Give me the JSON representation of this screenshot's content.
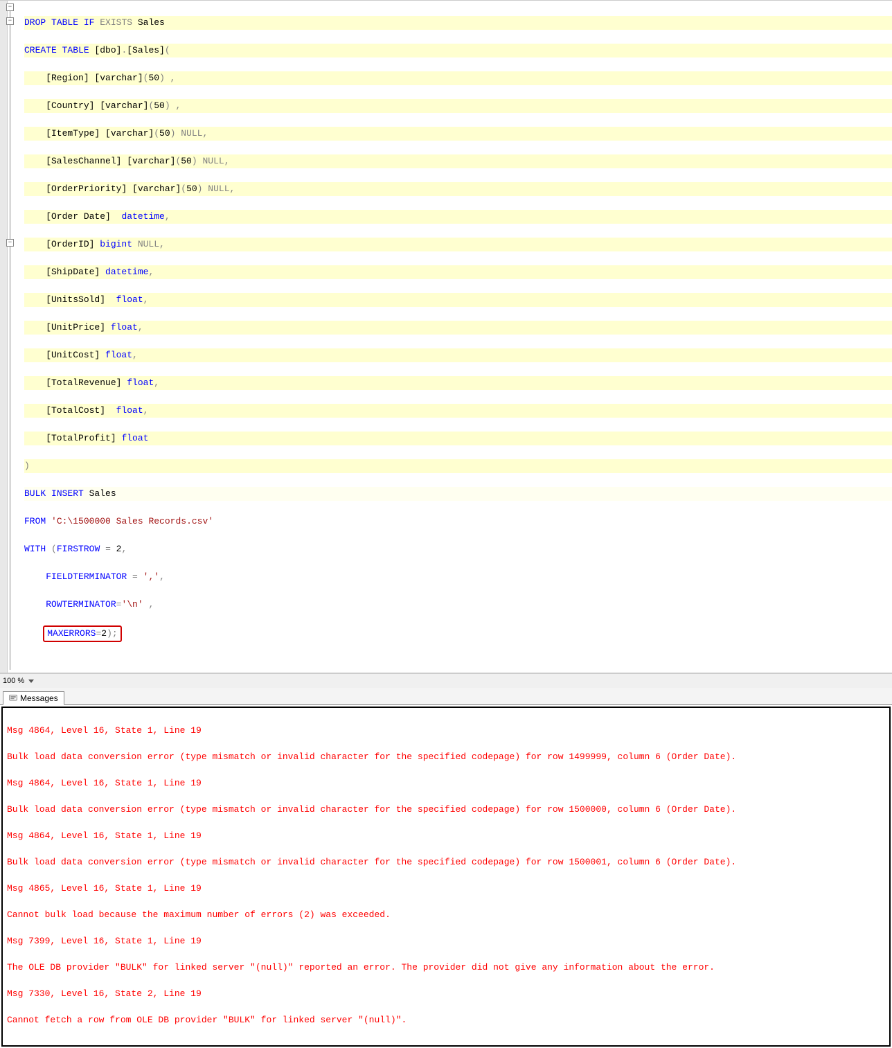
{
  "zoom": "100 %",
  "messagesTab": "Messages",
  "code": {
    "l1": {
      "a": "DROP",
      "b": " TABLE",
      "c": " IF",
      "d": " EXISTS",
      "e": " Sales"
    },
    "l2": {
      "a": "CREATE",
      "b": " TABLE",
      "c": " [dbo]",
      "d": ".",
      "e": "[Sales]",
      "f": "("
    },
    "l3": {
      "a": "    [Region] [varchar]",
      "b": "(",
      "c": "50",
      "d": ")",
      "e": " ,"
    },
    "l4": {
      "a": "    [Country] [varchar]",
      "b": "(",
      "c": "50",
      "d": ")",
      "e": " ,"
    },
    "l5": {
      "a": "    [ItemType] [varchar]",
      "b": "(",
      "c": "50",
      "d": ")",
      "e": " NULL",
      "f": ","
    },
    "l6": {
      "a": "    [SalesChannel] [varchar]",
      "b": "(",
      "c": "50",
      "d": ")",
      "e": " NULL",
      "f": ","
    },
    "l7": {
      "a": "    [OrderPriority] [varchar]",
      "b": "(",
      "c": "50",
      "d": ")",
      "e": " NULL",
      "f": ","
    },
    "l8": {
      "a": "    [Order Date]  ",
      "b": "datetime",
      "c": ","
    },
    "l9": {
      "a": "    [OrderID] ",
      "b": "bigint",
      "c": " NULL",
      "d": ","
    },
    "l10": {
      "a": "    [ShipDate] ",
      "b": "datetime",
      "c": ","
    },
    "l11": {
      "a": "    [UnitsSold]  ",
      "b": "float",
      "c": ","
    },
    "l12": {
      "a": "    [UnitPrice] ",
      "b": "float",
      "c": ","
    },
    "l13": {
      "a": "    [UnitCost] ",
      "b": "float",
      "c": ","
    },
    "l14": {
      "a": "    [TotalRevenue] ",
      "b": "float",
      "c": ","
    },
    "l15": {
      "a": "    [TotalCost]  ",
      "b": "float",
      "c": ","
    },
    "l16": {
      "a": "    [TotalProfit] ",
      "b": "float"
    },
    "l17": {
      "a": ")"
    },
    "l18": {
      "a": "BULK",
      "b": " INSERT",
      "c": " Sales"
    },
    "l19": {
      "a": "FROM",
      "b": " ",
      "c": "'C:\\1500000 Sales Records.csv'"
    },
    "l20": {
      "a": "WITH",
      "b": " ",
      "c": "(",
      "d": "FIRSTROW",
      "e": " =",
      "f": " 2",
      "g": ","
    },
    "l21": {
      "a": "    ",
      "b": "FIELDTERMINATOR",
      "c": " =",
      "d": " ",
      "e": "','",
      "f": ","
    },
    "l22": {
      "a": "    ",
      "b": "ROWTERMINATOR",
      "c": "=",
      "d": "'\\n'",
      "e": " ,"
    },
    "l23": {
      "a": "    ",
      "b": "MAXERRORS",
      "c": "=",
      "d": "2",
      "e": ")",
      "f": ";"
    }
  },
  "messages": {
    "m1": "Msg 4864, Level 16, State 1, Line 19",
    "m2": "Bulk load data conversion error (type mismatch or invalid character for the specified codepage) for row 1499999, column 6 (Order Date).",
    "m3": "Msg 4864, Level 16, State 1, Line 19",
    "m4": "Bulk load data conversion error (type mismatch or invalid character for the specified codepage) for row 1500000, column 6 (Order Date).",
    "m5": "Msg 4864, Level 16, State 1, Line 19",
    "m6": "Bulk load data conversion error (type mismatch or invalid character for the specified codepage) for row 1500001, column 6 (Order Date).",
    "m7": "Msg 4865, Level 16, State 1, Line 19",
    "m8": "Cannot bulk load because the maximum number of errors (2) was exceeded.",
    "m9": "Msg 7399, Level 16, State 1, Line 19",
    "m10": "The OLE DB provider \"BULK\" for linked server \"(null)\" reported an error. The provider did not give any information about the error.",
    "m11": "Msg 7330, Level 16, State 2, Line 19",
    "m12": "Cannot fetch a row from OLE DB provider \"BULK\" for linked server \"(null)\"."
  }
}
